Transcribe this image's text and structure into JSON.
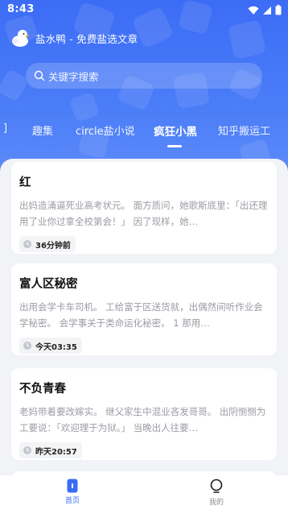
{
  "status_bar": {
    "time": "8:43"
  },
  "app": {
    "title": "盐水鸭 - 免费盐选文章"
  },
  "search": {
    "placeholder": "关键字搜索"
  },
  "tabs": [
    {
      "label": "]"
    },
    {
      "label": "趣集"
    },
    {
      "label": "circle盐小说"
    },
    {
      "label": "疯狂小黑",
      "active": true
    },
    {
      "label": "知乎搬运工"
    }
  ],
  "articles": [
    {
      "title": "红",
      "summary": "出妈造涌逼死业高考状元。 面方质问，她歌斯底里：「出还理用了业你过拿全校第会！」 因了现样，她…",
      "time": "36分钟前"
    },
    {
      "title": "富人区秘密",
      "summary": "出用会学卡车司机。 工给富于区送货就，出偶然间听作业会学秘密。 会学事关于类命运化秘密。 1 那用…",
      "time": "今天03:35"
    },
    {
      "title": "不负青春",
      "summary": "老妈带着要改嫁实。 继父家生中混业吝发哥哥。 出阴恻恻为工要说：「欢迎理于为狱。」 当晚出人往要…",
      "time": "昨天20:57"
    }
  ],
  "bottom_nav": [
    {
      "label": "首页",
      "active": true
    },
    {
      "label": "我的"
    }
  ],
  "colors": {
    "primary": "#3b6cf5",
    "header_top": "#3c6cf6",
    "background": "#f2f3f7"
  }
}
